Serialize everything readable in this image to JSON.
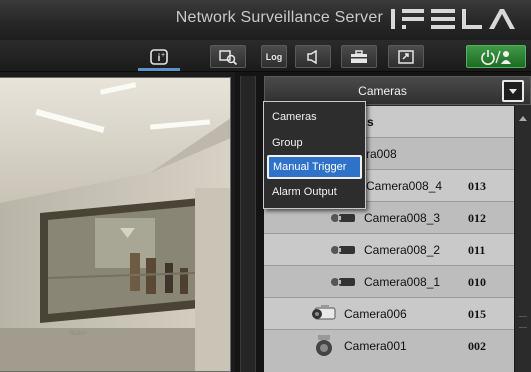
{
  "header": {
    "title": "Network Surveillance Server",
    "brand": "IPELA"
  },
  "toolbar": {
    "info_icon": "info-icon",
    "log_label": "Log",
    "icons": [
      "info-icon",
      "search-camera-icon",
      "log-icon",
      "speaker-icon",
      "toolbox-icon",
      "window-restore-icon",
      "power-user-icon"
    ]
  },
  "video": {
    "camera_label": "SONY"
  },
  "panel": {
    "title": "Cameras",
    "dropdown_icon": "chevron-down-icon"
  },
  "menu": {
    "items": [
      "Cameras",
      "Group",
      "Manual Trigger",
      "Alarm Output"
    ],
    "selected": "Manual Trigger"
  },
  "list": {
    "header_partial": "s",
    "rows": [
      {
        "name": "ra008",
        "number": ""
      },
      {
        "name": "Camera008_4",
        "number": "013"
      },
      {
        "name": "Camera008_3",
        "number": "012"
      },
      {
        "name": "Camera008_2",
        "number": "011"
      },
      {
        "name": "Camera008_1",
        "number": "010"
      },
      {
        "name": "Camera006",
        "number": "015"
      },
      {
        "name": "Camera001",
        "number": "002"
      }
    ]
  },
  "colors": {
    "accent": "#2f72c9",
    "power": "#2e8b36",
    "list_bg": "#bdbdbd"
  }
}
